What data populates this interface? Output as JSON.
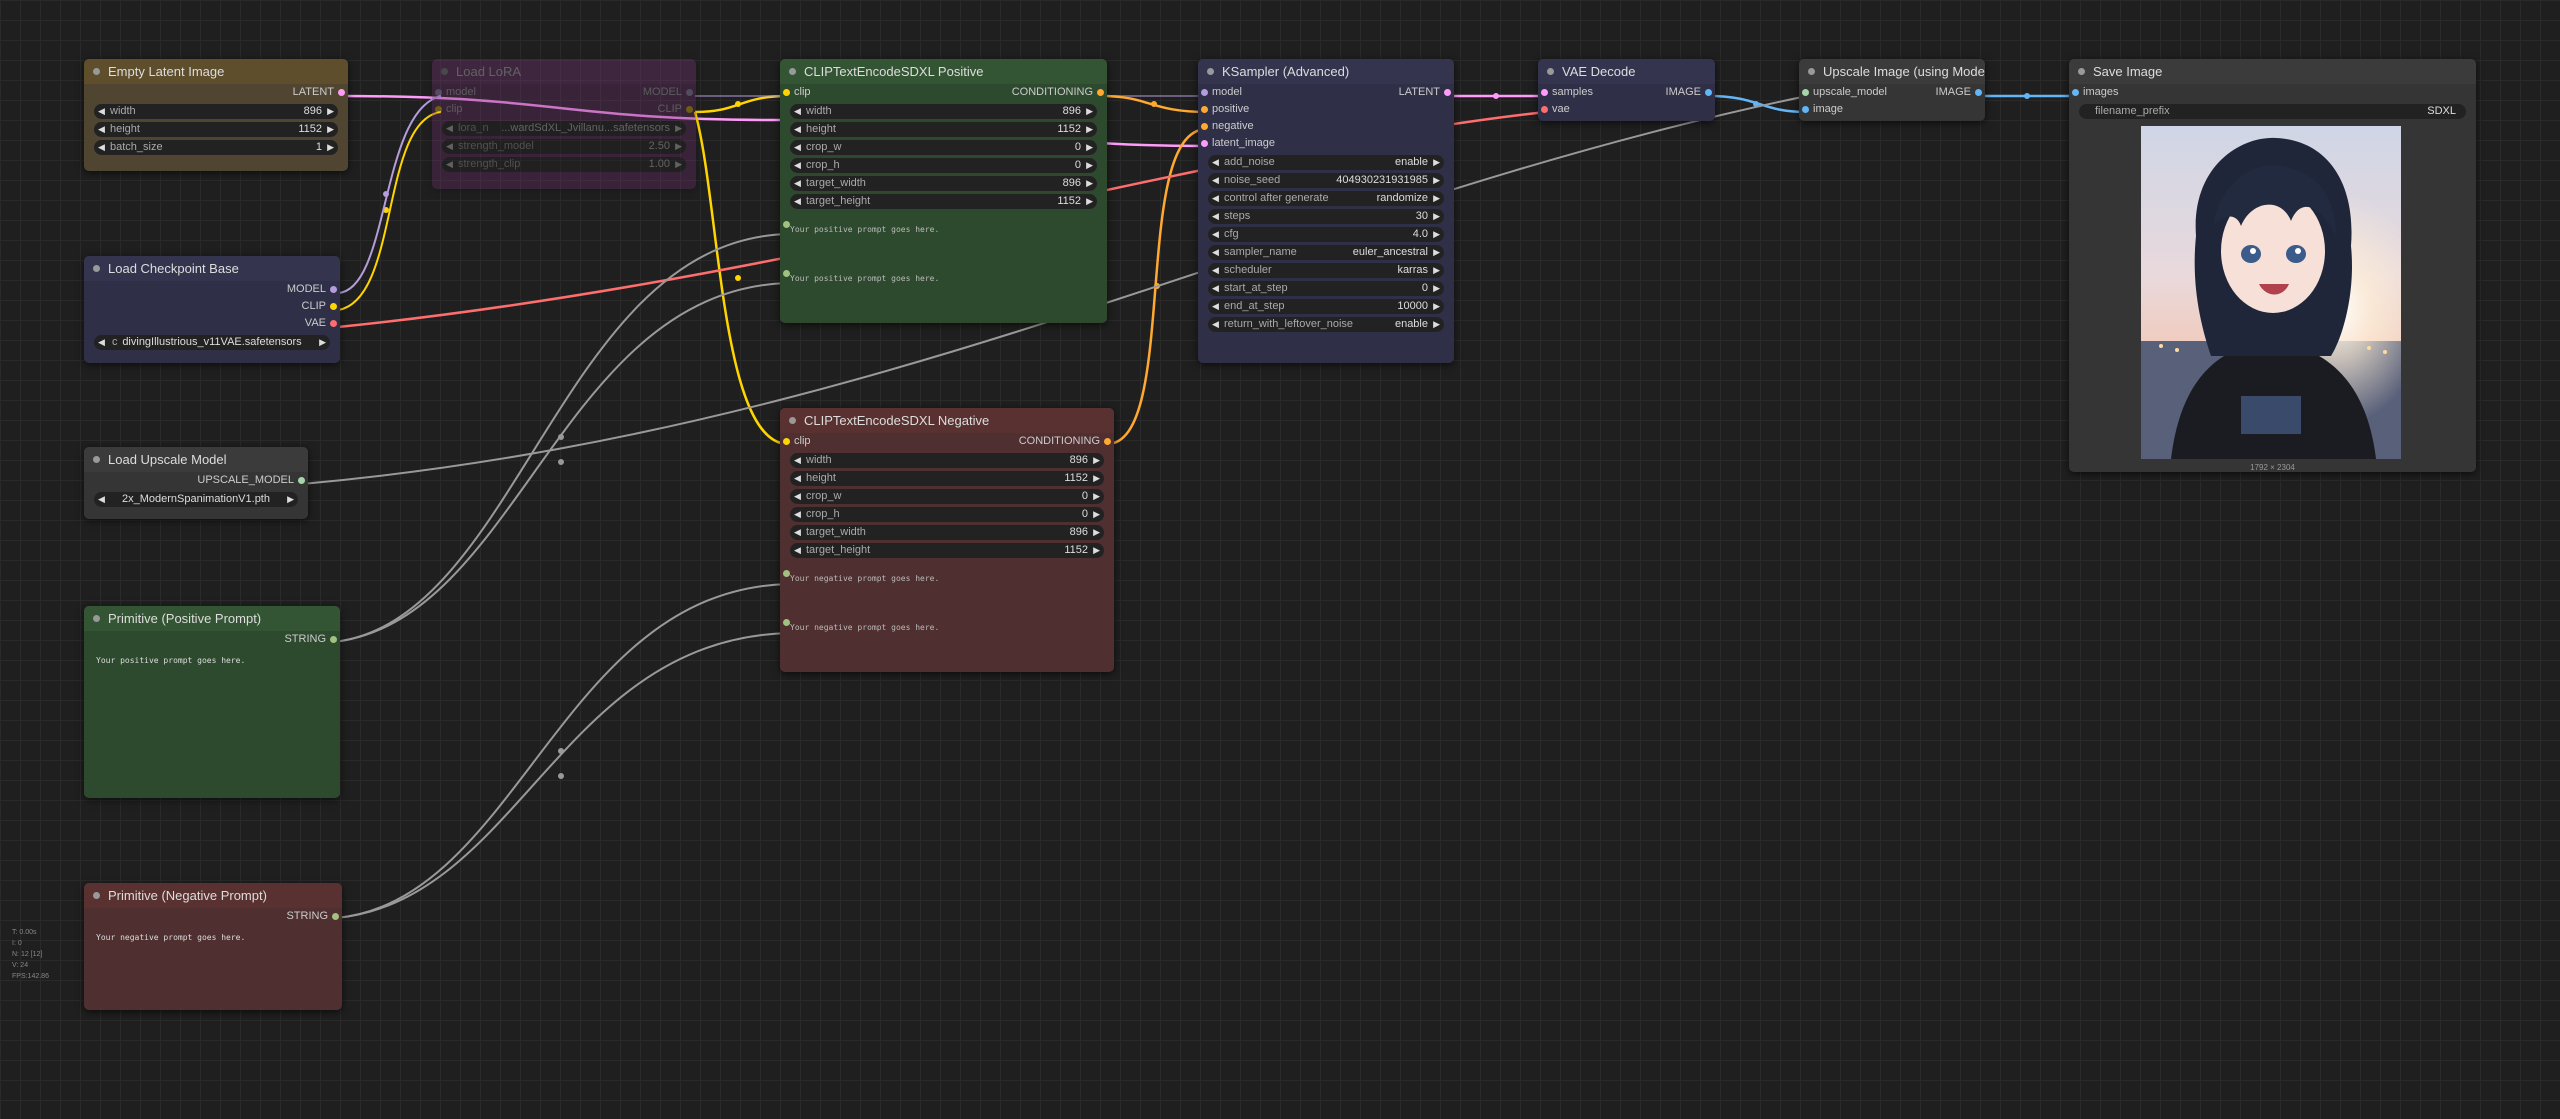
{
  "colors": {
    "latent": "#FF9CF9",
    "clip": "#FFD500",
    "vae": "#FF6E6E",
    "model": "#B39DDB",
    "conditioning": "#FFA931",
    "image": "#64B5F6",
    "upscale_model": "#A5D6A7",
    "string": "#A1C181"
  },
  "nodes": {
    "empty_latent": {
      "title": "Empty Latent Image",
      "output": "LATENT",
      "widgets": [
        {
          "name": "width",
          "value": "896"
        },
        {
          "name": "height",
          "value": "1152"
        },
        {
          "name": "batch_size",
          "value": "1"
        }
      ]
    },
    "load_lora": {
      "title": "Load LoRA",
      "inputs": [
        "model",
        "clip"
      ],
      "outputs": [
        "MODEL",
        "CLIP"
      ],
      "widgets": [
        {
          "name": "lora_n",
          "value": "...wardSdXL_Jvillanu...safetensors"
        },
        {
          "name": "strength_model",
          "value": "2.50"
        },
        {
          "name": "strength_clip",
          "value": "1.00"
        }
      ]
    },
    "load_checkpoint": {
      "title": "Load Checkpoint Base",
      "outputs": [
        "MODEL",
        "CLIP",
        "VAE"
      ],
      "widget_prefix": "c",
      "widget_value": "divingIllustrious_v11VAE.safetensors"
    },
    "load_upscale": {
      "title": "Load Upscale Model",
      "output": "UPSCALE_MODEL",
      "widget_value": "2x_ModernSpanimationV1.pth"
    },
    "prim_pos": {
      "title": "Primitive (Positive Prompt)",
      "output": "STRING",
      "text": "Your positive prompt goes here."
    },
    "prim_neg": {
      "title": "Primitive (Negative Prompt)",
      "output": "STRING",
      "text": "Your negative prompt goes here."
    },
    "clip_pos": {
      "title": "CLIPTextEncodeSDXL Positive",
      "input": "clip",
      "output": "CONDITIONING",
      "widgets": [
        {
          "name": "width",
          "value": "896"
        },
        {
          "name": "height",
          "value": "1152"
        },
        {
          "name": "crop_w",
          "value": "0"
        },
        {
          "name": "crop_h",
          "value": "0"
        },
        {
          "name": "target_width",
          "value": "896"
        },
        {
          "name": "target_height",
          "value": "1152"
        }
      ],
      "text_g": "Your positive prompt goes here.",
      "text_l": "Your positive prompt goes here."
    },
    "clip_neg": {
      "title": "CLIPTextEncodeSDXL Negative",
      "input": "clip",
      "output": "CONDITIONING",
      "widgets": [
        {
          "name": "width",
          "value": "896"
        },
        {
          "name": "height",
          "value": "1152"
        },
        {
          "name": "crop_w",
          "value": "0"
        },
        {
          "name": "crop_h",
          "value": "0"
        },
        {
          "name": "target_width",
          "value": "896"
        },
        {
          "name": "target_height",
          "value": "1152"
        }
      ],
      "text_g": "Your negative prompt goes here.",
      "text_l": "Your negative prompt goes here."
    },
    "ksampler": {
      "title": "KSampler (Advanced)",
      "inputs": [
        "model",
        "positive",
        "negative",
        "latent_image"
      ],
      "output": "LATENT",
      "widgets": [
        {
          "name": "add_noise",
          "value": "enable"
        },
        {
          "name": "noise_seed",
          "value": "404930231931985"
        },
        {
          "name": "control after generate",
          "value": "randomize"
        },
        {
          "name": "steps",
          "value": "30"
        },
        {
          "name": "cfg",
          "value": "4.0"
        },
        {
          "name": "sampler_name",
          "value": "euler_ancestral"
        },
        {
          "name": "scheduler",
          "value": "karras"
        },
        {
          "name": "start_at_step",
          "value": "0"
        },
        {
          "name": "end_at_step",
          "value": "10000"
        },
        {
          "name": "return_with_leftover_noise",
          "value": "enable"
        }
      ]
    },
    "vae_decode": {
      "title": "VAE Decode",
      "inputs": [
        "samples",
        "vae"
      ],
      "output": "IMAGE"
    },
    "upscale_image": {
      "title": "Upscale Image (using Model)",
      "inputs": [
        "upscale_model",
        "image"
      ],
      "output": "IMAGE"
    },
    "save_image": {
      "title": "Save Image",
      "input": "images",
      "widget_name": "filename_prefix",
      "widget_value": "SDXL",
      "caption": "1792 × 2304"
    }
  },
  "stats": {
    "t": "T: 0.00s",
    "i": "I: 0",
    "n": "N: 12 [12]",
    "v": "V: 24",
    "fps": "FPS:142.86"
  }
}
